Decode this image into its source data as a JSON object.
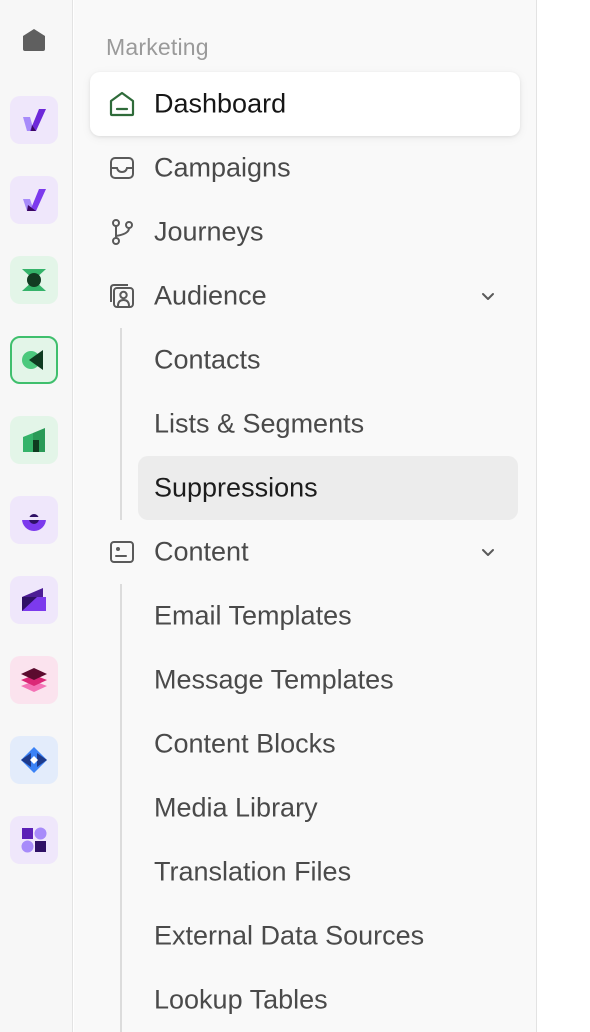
{
  "rail": {
    "apps": [
      {
        "icon": "home-icon"
      },
      {
        "icon": "purple-check-logo-icon",
        "accent": "#7c3aed"
      },
      {
        "icon": "purple-check-logo-alt-icon",
        "accent": "#7c3aed"
      },
      {
        "icon": "green-hourglass-logo-icon",
        "accent": "#22a05a"
      },
      {
        "icon": "green-play-logo-icon",
        "accent": "#22a05a"
      },
      {
        "icon": "green-bars-logo-icon",
        "accent": "#22a05a"
      },
      {
        "icon": "purple-semicircle-logo-icon",
        "accent": "#7c3aed"
      },
      {
        "icon": "purple-box-logo-icon",
        "accent": "#5b21b6"
      },
      {
        "icon": "pink-layers-logo-icon",
        "accent": "#db2777"
      },
      {
        "icon": "blue-diamond-logo-icon",
        "accent": "#2563eb"
      },
      {
        "icon": "purple-blocks-logo-icon",
        "accent": "#7c3aed"
      }
    ]
  },
  "nav": {
    "section_label": "Marketing",
    "items": {
      "dashboard": {
        "label": "Dashboard",
        "icon": "dashboard-icon"
      },
      "campaigns": {
        "label": "Campaigns",
        "icon": "inbox-icon"
      },
      "journeys": {
        "label": "Journeys",
        "icon": "branch-icon"
      },
      "audience": {
        "label": "Audience",
        "icon": "contacts-icon"
      },
      "content": {
        "label": "Content",
        "icon": "content-icon"
      }
    },
    "audience_children": [
      "Contacts",
      "Lists & Segments",
      "Suppressions"
    ],
    "content_children": [
      "Email Templates",
      "Message Templates",
      "Content Blocks",
      "Media Library",
      "Translation Files",
      "External Data Sources",
      "Lookup Tables"
    ]
  },
  "colors": {
    "active_icon": "#2f6b3a",
    "text": "#4a4a4a",
    "muted": "#9a9a9a",
    "selected_bg": "#ececec"
  }
}
